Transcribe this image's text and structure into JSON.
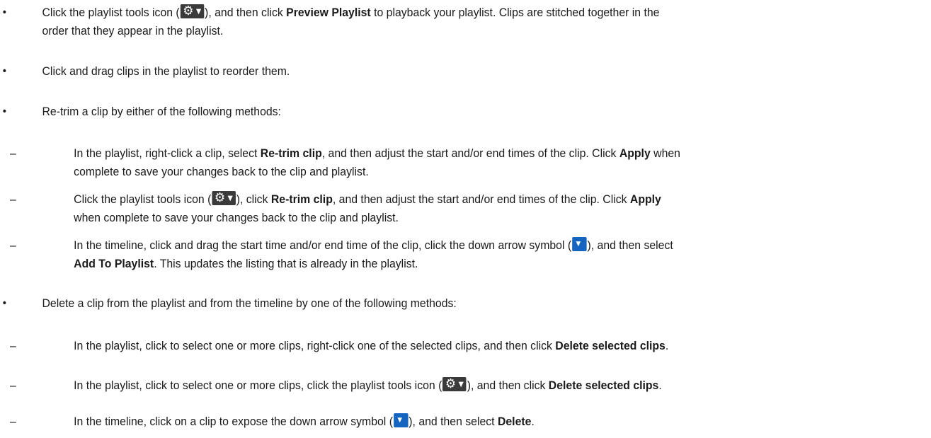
{
  "icons": {
    "tools": "gear-with-dropdown-icon",
    "tools_color": "#3a3a3a",
    "down_arrow": "blue-down-arrow-icon",
    "down_arrow_color": "#1565c0"
  },
  "markers": {
    "bullet": "•",
    "dash": "–"
  },
  "items": [
    {
      "t1": "Click the playlist tools icon (",
      "t2": "), and then click ",
      "b1": "Preview Playlist",
      "t3": " to playback your playlist. Clips are stitched together in the",
      "line2": "order that they appear in the playlist."
    },
    {
      "t1": "Click and drag clips in the playlist to reorder them."
    },
    {
      "t1": "Re-trim a clip by either of the following methods:"
    },
    {
      "t1": "In the playlist, right-click a clip, select ",
      "b1": "Re-trim clip",
      "t2": ", and then adjust the start and/or end times of the clip. Click ",
      "b2": "Apply",
      "t3": " when",
      "line2": "complete to save your changes back to the clip and playlist."
    },
    {
      "t1": "Click the playlist tools icon (",
      "t2": "), click ",
      "b1": "Re-trim clip",
      "t3": ", and then adjust the start and/or end times of the clip. Click ",
      "b2": "Apply",
      "line2": "when complete to save your changes back to the clip and playlist."
    },
    {
      "t1": "In the timeline, click and drag the start time and/or end time of the clip, click the down arrow symbol (",
      "t2": "), and then select",
      "b1": "Add To Playlist",
      "t3": ". This updates the listing that is already in the playlist."
    },
    {
      "t1": "Delete a clip from the playlist and from the timeline by one of the following methods:"
    },
    {
      "t1": "In the playlist, click to select one or more clips, right-click one of the selected clips, and then click ",
      "b1": "Delete selected clips",
      "t2": "."
    },
    {
      "t1": "In the playlist, click to select one or more clips, click the playlist tools icon (",
      "t2": "), and then click ",
      "b1": "Delete selected clips",
      "t3": "."
    },
    {
      "t1": "In the timeline, click on a clip to expose the down arrow symbol (",
      "t2": "), and then select ",
      "b1": "Delete",
      "t3": "."
    }
  ]
}
